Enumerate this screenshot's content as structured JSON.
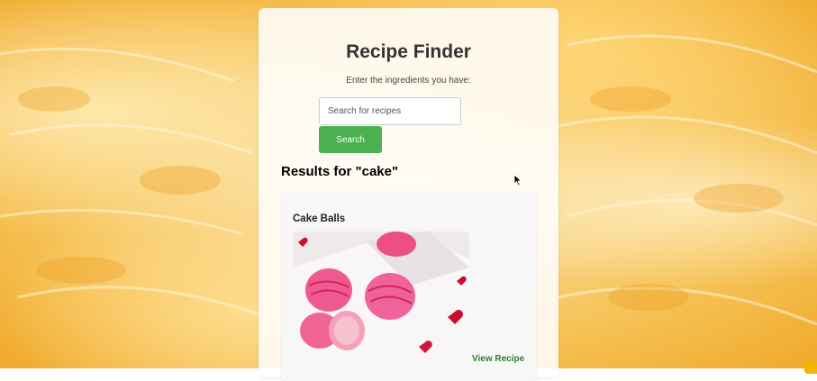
{
  "app": {
    "title": "Recipe Finder",
    "subtitle": "Enter the ingredients you have:"
  },
  "search": {
    "placeholder": "Search for recipes",
    "value": "",
    "button_label": "Search"
  },
  "results": {
    "heading": "Results for \"cake\"",
    "items": [
      {
        "title": "Cake Balls",
        "image_icon": "cake-balls-photo",
        "link_label": "View Recipe"
      }
    ]
  },
  "colors": {
    "accent": "#4caf50",
    "link": "#2e7d32",
    "background": "#f6c45a"
  }
}
